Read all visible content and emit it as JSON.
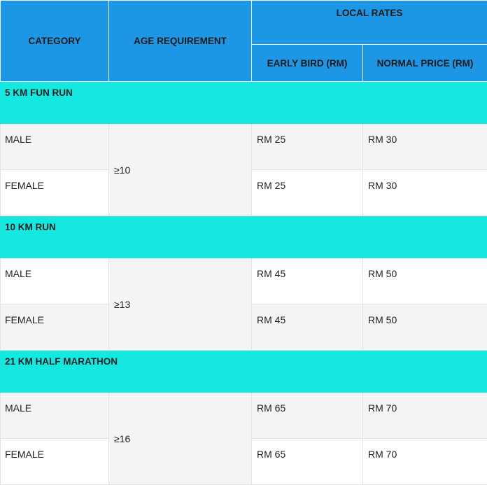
{
  "headers": {
    "category": "CATEGORY",
    "age": "AGE REQUIREMENT",
    "local_rates": "LOCAL RATES",
    "early_bird": "EARLY BIRD (RM)",
    "normal_price": "NORMAL PRICE (RM)"
  },
  "sections": [
    {
      "title": "5 KM FUN RUN",
      "age": "≥10",
      "rows": [
        {
          "category": "MALE",
          "early": "RM 25",
          "normal": "RM 30"
        },
        {
          "category": "FEMALE",
          "early": "RM 25",
          "normal": "RM 30"
        }
      ]
    },
    {
      "title": "10 KM RUN",
      "age": "≥13",
      "rows": [
        {
          "category": "MALE",
          "early": "RM 45",
          "normal": "RM 50"
        },
        {
          "category": "FEMALE",
          "early": "RM 45",
          "normal": "RM 50"
        }
      ]
    },
    {
      "title": "21 KM HALF MARATHON",
      "age": "≥16",
      "rows": [
        {
          "category": "MALE",
          "early": "RM 65",
          "normal": "RM 70"
        },
        {
          "category": "FEMALE",
          "early": "RM 65",
          "normal": "RM 70"
        }
      ]
    }
  ],
  "colors": {
    "header": "#1d96e6",
    "section": "#14e8e0",
    "stripe": "#f4f4f4"
  }
}
